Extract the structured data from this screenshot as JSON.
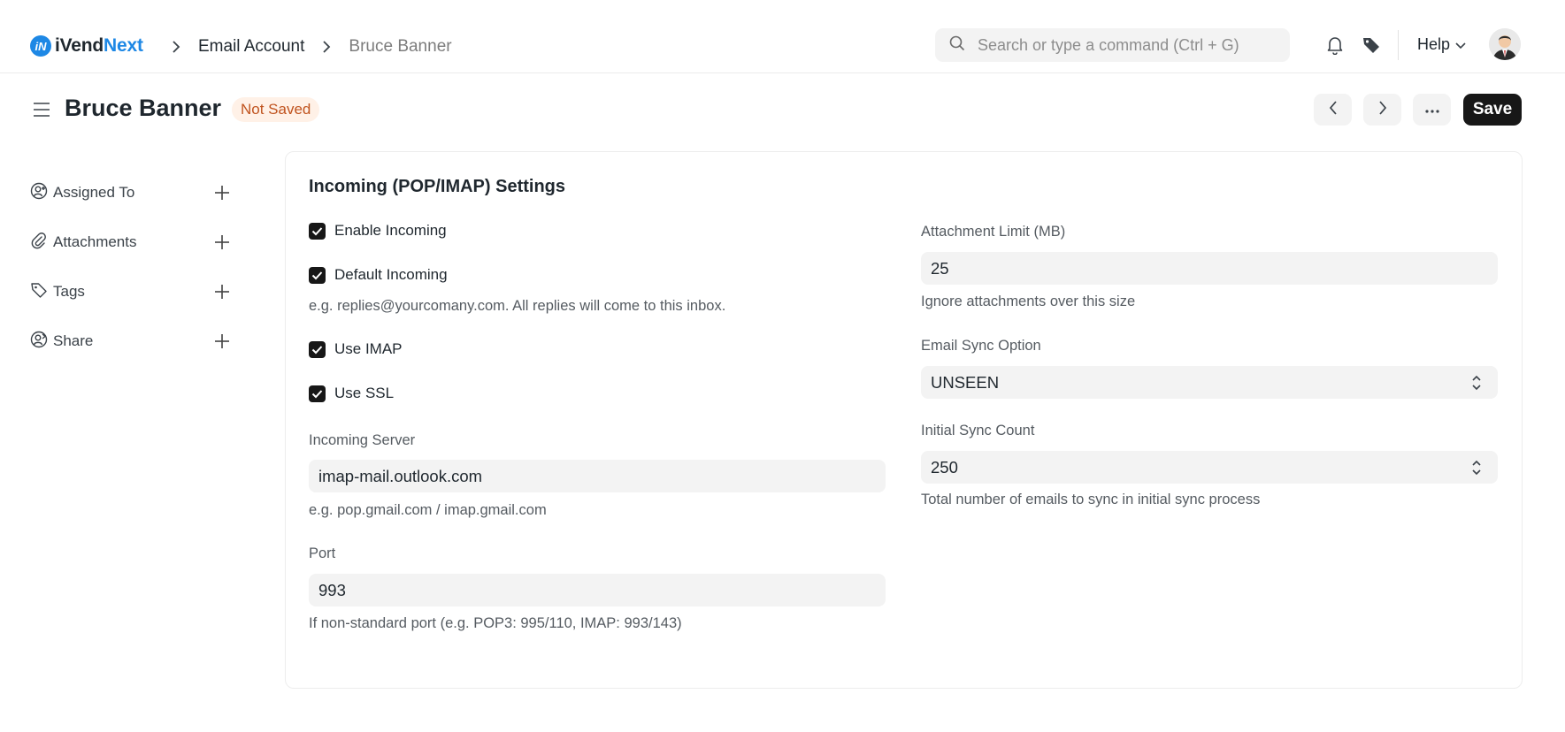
{
  "navbar": {
    "logo_prefix": "iVend",
    "logo_suffix": "Next",
    "breadcrumb": [
      "Email Account",
      "Bruce Banner"
    ],
    "search_placeholder": "Search or type a command (Ctrl + G)",
    "help_label": "Help"
  },
  "page": {
    "title": "Bruce Banner",
    "status": "Not Saved",
    "save_label": "Save"
  },
  "sidebar": {
    "items": [
      {
        "label": "Assigned To",
        "icon": "user-plus-icon"
      },
      {
        "label": "Attachments",
        "icon": "paperclip-icon"
      },
      {
        "label": "Tags",
        "icon": "tag-icon"
      },
      {
        "label": "Share",
        "icon": "share-user-icon"
      }
    ]
  },
  "form": {
    "section_title": "Incoming (POP/IMAP) Settings",
    "enable_incoming": {
      "label": "Enable Incoming",
      "checked": true
    },
    "default_incoming": {
      "label": "Default Incoming",
      "checked": true,
      "description": "e.g. replies@yourcomany.com. All replies will come to this inbox."
    },
    "use_imap": {
      "label": "Use IMAP",
      "checked": true
    },
    "use_ssl": {
      "label": "Use SSL",
      "checked": true
    },
    "incoming_server": {
      "label": "Incoming Server",
      "value": "imap-mail.outlook.com",
      "description": "e.g. pop.gmail.com / imap.gmail.com"
    },
    "port": {
      "label": "Port",
      "value": "993",
      "description": "If non-standard port (e.g. POP3: 995/110, IMAP: 993/143)"
    },
    "attachment_limit": {
      "label": "Attachment Limit (MB)",
      "value": "25",
      "description": "Ignore attachments over this size"
    },
    "email_sync_option": {
      "label": "Email Sync Option",
      "value": "UNSEEN"
    },
    "initial_sync_count": {
      "label": "Initial Sync Count",
      "value": "250",
      "description": "Total number of emails to sync in initial sync process"
    }
  },
  "colors": {
    "accent": "#1e88e5",
    "primary_button": "#171717",
    "status_badge_bg": "#fff1e7",
    "status_badge_text": "#c0531e"
  }
}
